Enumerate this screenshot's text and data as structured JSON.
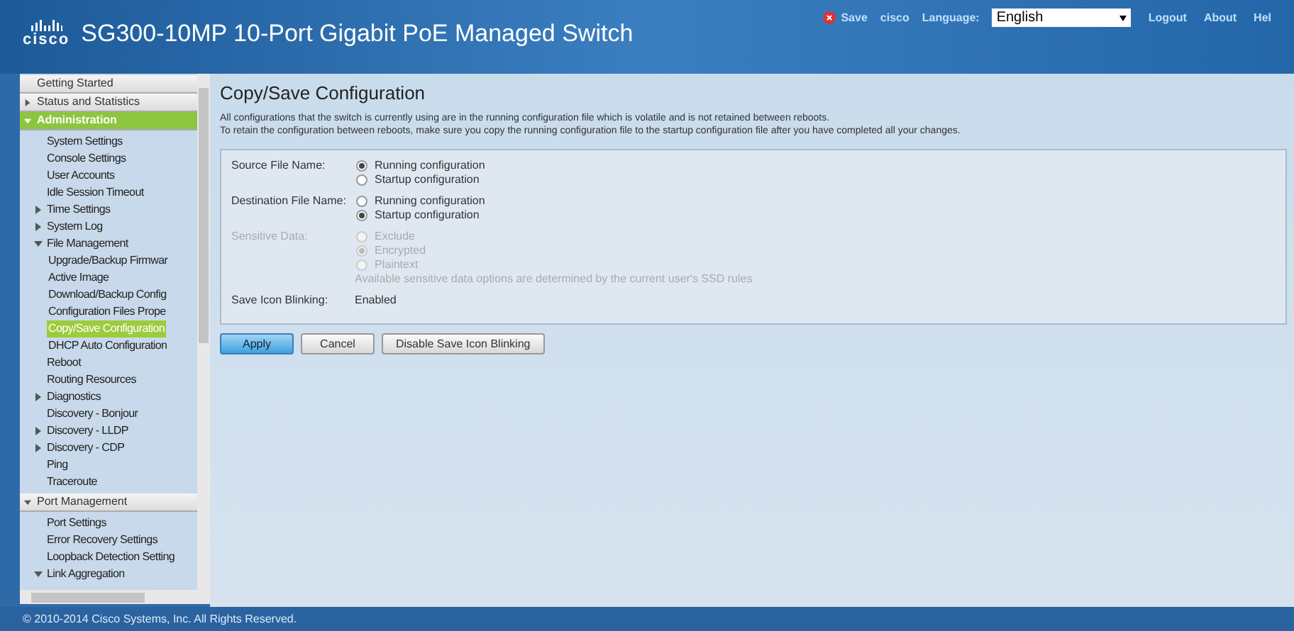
{
  "header": {
    "logo": "cisco",
    "title": "SG300-10MP 10-Port Gigabit PoE Managed Switch",
    "save": "Save",
    "user": "cisco",
    "language_label": "Language:",
    "language": "English",
    "links": [
      "Logout",
      "About",
      "Hel"
    ]
  },
  "sidebar": {
    "items": [
      {
        "label": "Getting Started",
        "has_arrow": false,
        "selected": false
      },
      {
        "label": "Status and Statistics",
        "expanded": false,
        "has_arrow": true,
        "selected": false
      },
      {
        "label": "Administration",
        "expanded": true,
        "has_arrow": true,
        "selected": true,
        "children": [
          {
            "label": "System Settings",
            "has_arrow": false,
            "selected": false
          },
          {
            "label": "Console Settings",
            "has_arrow": false,
            "selected": false
          },
          {
            "label": "User Accounts",
            "has_arrow": false,
            "selected": false
          },
          {
            "label": "Idle Session Timeout",
            "has_arrow": false,
            "selected": false
          },
          {
            "label": "Time Settings",
            "has_arrow": true,
            "expanded": false,
            "selected": false
          },
          {
            "label": "System Log",
            "has_arrow": true,
            "expanded": false,
            "selected": false
          },
          {
            "label": "File Management",
            "has_arrow": true,
            "expanded": true,
            "selected": false,
            "children": [
              {
                "label": "Upgrade/Backup Firmwar",
                "selected": false
              },
              {
                "label": "Active Image",
                "selected": false
              },
              {
                "label": "Download/Backup Config",
                "selected": false
              },
              {
                "label": "Configuration Files Prope",
                "selected": false
              },
              {
                "label": "Copy/Save Configuration",
                "selected": true
              },
              {
                "label": "DHCP Auto Configuration",
                "selected": false
              }
            ]
          },
          {
            "label": "Reboot",
            "has_arrow": false,
            "selected": false
          },
          {
            "label": "Routing Resources",
            "has_arrow": false,
            "selected": false
          },
          {
            "label": "Diagnostics",
            "has_arrow": true,
            "expanded": false,
            "selected": false
          },
          {
            "label": "Discovery - Bonjour",
            "has_arrow": false,
            "selected": false
          },
          {
            "label": "Discovery - LLDP",
            "has_arrow": true,
            "expanded": false,
            "selected": false
          },
          {
            "label": "Discovery - CDP",
            "has_arrow": true,
            "expanded": false,
            "selected": false
          },
          {
            "label": "Ping",
            "has_arrow": false,
            "selected": false
          },
          {
            "label": "Traceroute",
            "has_arrow": false,
            "selected": false
          }
        ]
      },
      {
        "label": "Port Management",
        "expanded": true,
        "has_arrow": true,
        "selected": false,
        "children": [
          {
            "label": "Port Settings",
            "has_arrow": false,
            "selected": false
          },
          {
            "label": "Error Recovery Settings",
            "has_arrow": false,
            "selected": false
          },
          {
            "label": "Loopback Detection Setting",
            "has_arrow": false,
            "selected": false
          },
          {
            "label": "Link Aggregation",
            "has_arrow": true,
            "expanded": true,
            "selected": false
          }
        ]
      }
    ]
  },
  "page": {
    "title": "Copy/Save Configuration",
    "description": [
      "All configurations that the switch is currently using are in the running configuration file which is volatile and is not retained between reboots.",
      "To retain the configuration between reboots, make sure you copy the running configuration file to the startup configuration file after you have completed all your changes."
    ],
    "fields": [
      {
        "label": "Source File Name:",
        "kind": "radio",
        "disabled": false,
        "options": [
          {
            "label": "Running configuration",
            "selected": true
          },
          {
            "label": "Startup configuration",
            "selected": false
          }
        ]
      },
      {
        "label": "Destination File Name:",
        "kind": "radio",
        "disabled": false,
        "options": [
          {
            "label": "Running configuration",
            "selected": false
          },
          {
            "label": "Startup configuration",
            "selected": true
          }
        ]
      },
      {
        "label": "Sensitive Data:",
        "kind": "radio",
        "disabled": true,
        "options": [
          {
            "label": "Exclude",
            "selected": false
          },
          {
            "label": "Encrypted",
            "selected": true
          },
          {
            "label": "Plaintext",
            "selected": false
          }
        ],
        "note": "Available sensitive data options are determined by the current user's SSD rules"
      },
      {
        "label": "Save Icon Blinking:",
        "kind": "text",
        "disabled": false,
        "value": "Enabled"
      }
    ],
    "buttons": [
      {
        "label": "Apply",
        "primary": true
      },
      {
        "label": "Cancel",
        "primary": false
      },
      {
        "label": "Disable Save Icon Blinking",
        "primary": false
      }
    ]
  },
  "footer": "© 2010-2014 Cisco Systems, Inc. All Rights Reserved."
}
